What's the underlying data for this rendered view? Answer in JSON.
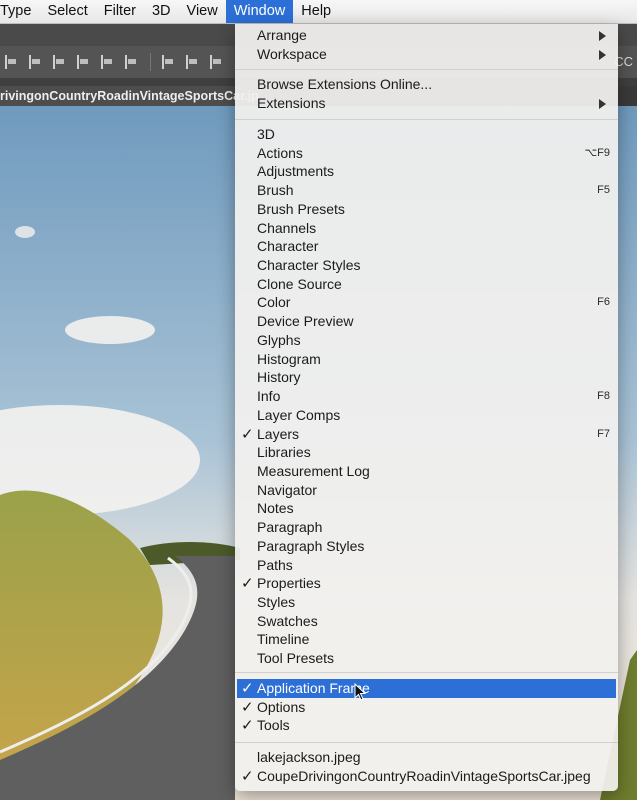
{
  "menubar": {
    "items": [
      "Type",
      "Select",
      "Filter",
      "3D",
      "View",
      "Window",
      "Help"
    ],
    "active": "Window"
  },
  "toolbar": {
    "right_text": "CC"
  },
  "document": {
    "tab_title": "rivingonCountryRoadinVintageSportsCar.jp"
  },
  "window_menu": {
    "groups": [
      [
        {
          "label": "Arrange",
          "submenu": true
        },
        {
          "label": "Workspace",
          "submenu": true
        }
      ],
      [
        {
          "label": "Browse Extensions Online..."
        },
        {
          "label": "Extensions",
          "submenu": true
        }
      ],
      [
        {
          "label": "3D"
        },
        {
          "label": "Actions",
          "shortcut": "⌥F9"
        },
        {
          "label": "Adjustments"
        },
        {
          "label": "Brush",
          "shortcut": "F5"
        },
        {
          "label": "Brush Presets"
        },
        {
          "label": "Channels"
        },
        {
          "label": "Character"
        },
        {
          "label": "Character Styles"
        },
        {
          "label": "Clone Source"
        },
        {
          "label": "Color",
          "shortcut": "F6"
        },
        {
          "label": "Device Preview"
        },
        {
          "label": "Glyphs"
        },
        {
          "label": "Histogram"
        },
        {
          "label": "History"
        },
        {
          "label": "Info",
          "shortcut": "F8"
        },
        {
          "label": "Layer Comps"
        },
        {
          "label": "Layers",
          "checked": true,
          "shortcut": "F7"
        },
        {
          "label": "Libraries"
        },
        {
          "label": "Measurement Log"
        },
        {
          "label": "Navigator"
        },
        {
          "label": "Notes"
        },
        {
          "label": "Paragraph"
        },
        {
          "label": "Paragraph Styles"
        },
        {
          "label": "Paths"
        },
        {
          "label": "Properties",
          "checked": true
        },
        {
          "label": "Styles"
        },
        {
          "label": "Swatches"
        },
        {
          "label": "Timeline"
        },
        {
          "label": "Tool Presets"
        }
      ],
      [
        {
          "label": "Application Frame",
          "checked": true,
          "highlighted": true
        },
        {
          "label": "Options",
          "checked": true
        },
        {
          "label": "Tools",
          "checked": true
        }
      ],
      [
        {
          "label": "lakejackson.jpeg"
        },
        {
          "label": "CoupeDrivingonCountryRoadinVintageSportsCar.jpeg",
          "checked": true
        }
      ]
    ],
    "check_glyph": "✓"
  },
  "colors": {
    "highlight": "#2c6fd6",
    "sky_top": "#5f8fb7",
    "sky_bottom": "#d8dde2",
    "hills": "#6f7d2e",
    "road": "#6a6a6a"
  }
}
